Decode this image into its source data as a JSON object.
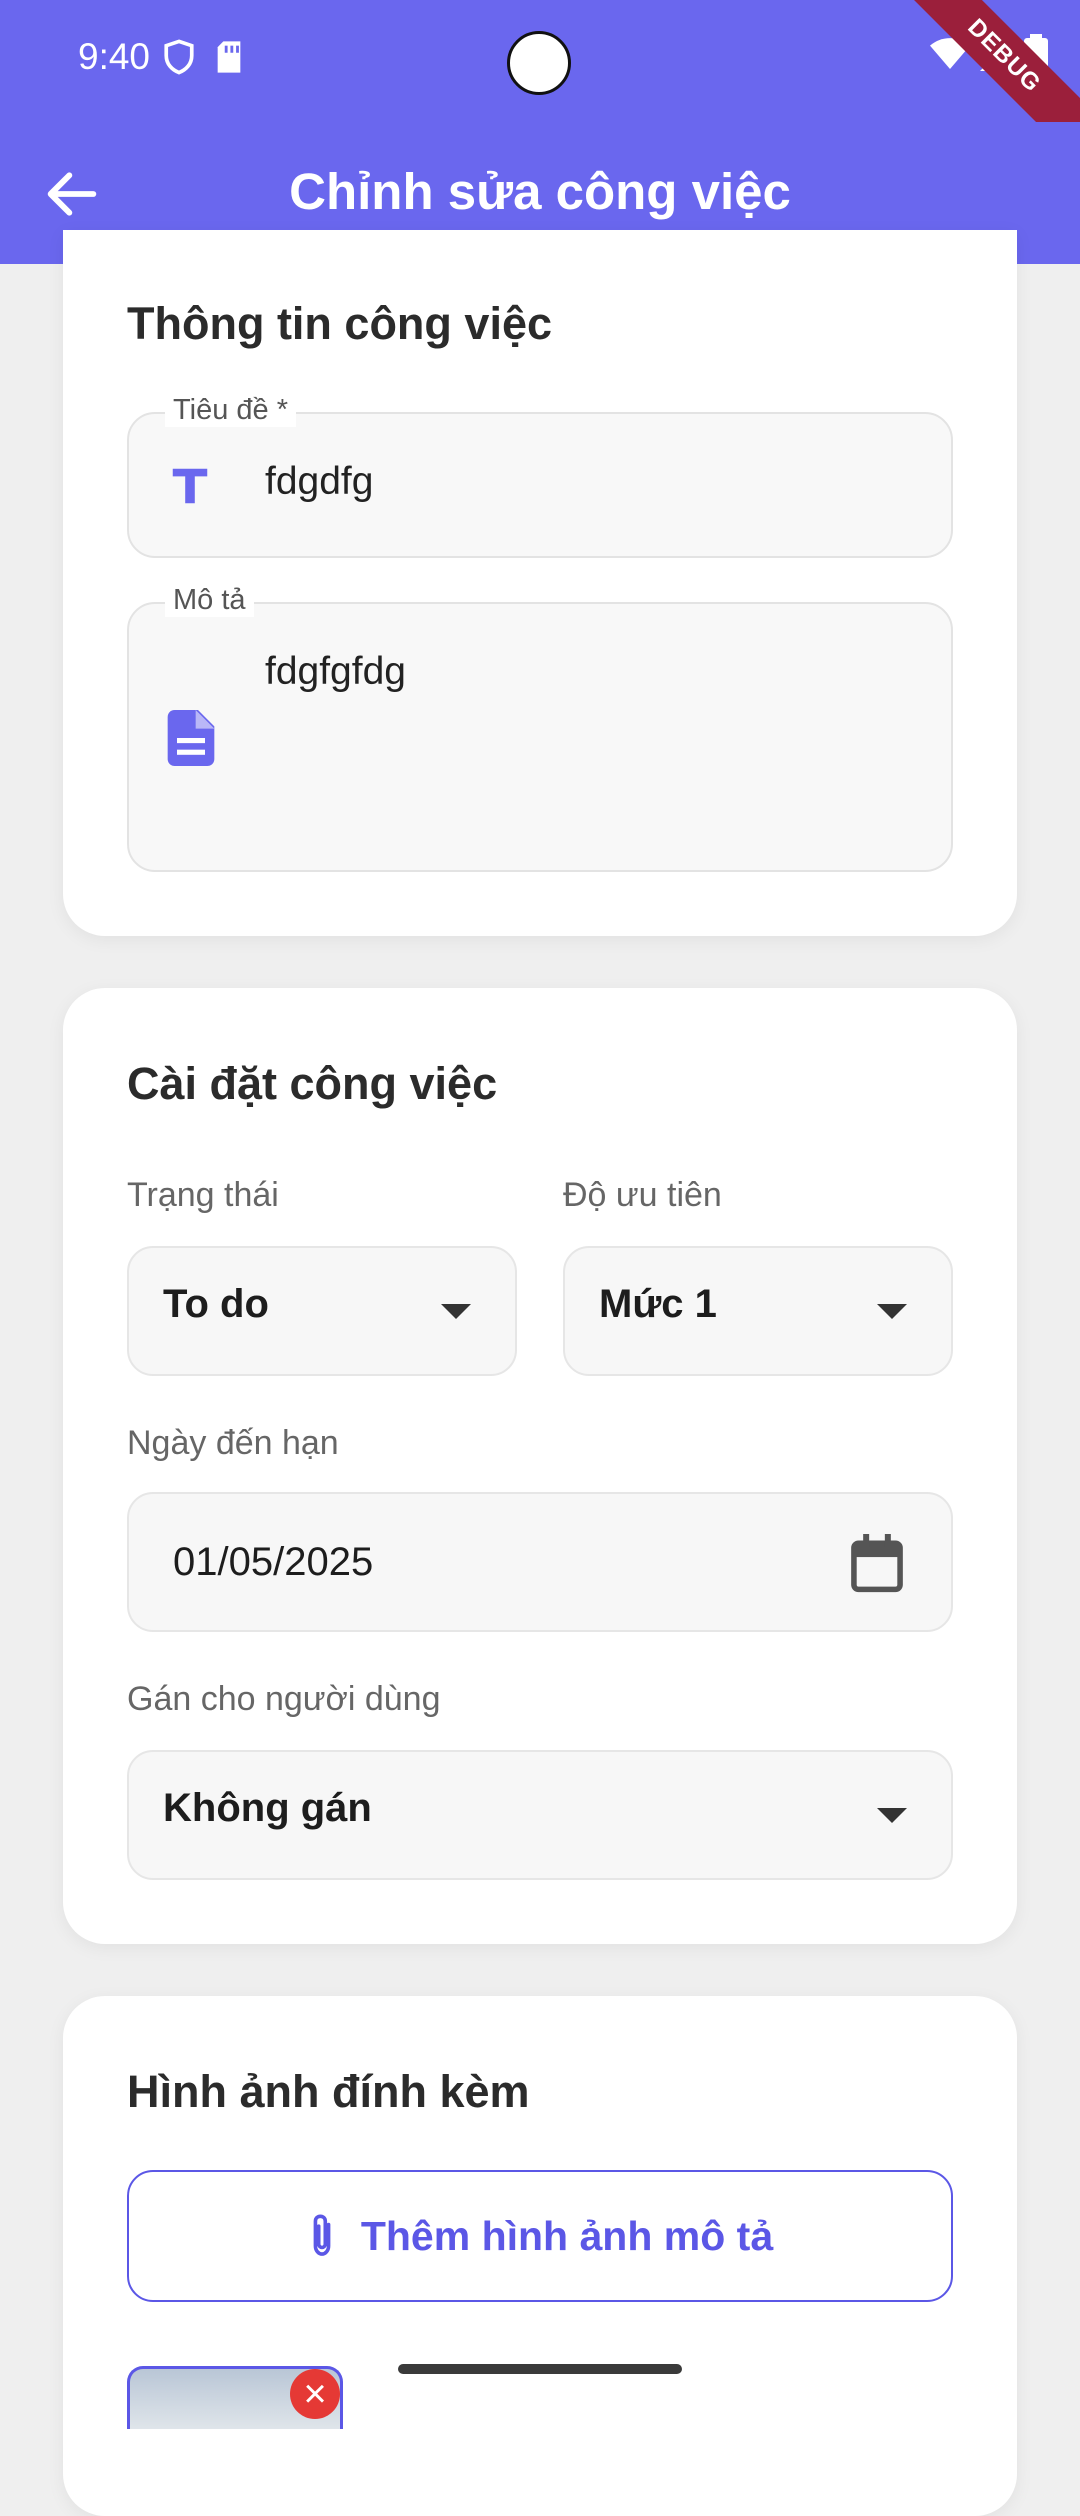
{
  "status_bar": {
    "time": "9:40",
    "debug_label": "DEBUG"
  },
  "app_bar": {
    "title": "Chỉnh sửa công việc"
  },
  "task_info": {
    "title": "Thông tin công việc",
    "title_field": {
      "label": "Tiêu đề *",
      "value": "fdgdfg",
      "icon": "title-icon"
    },
    "description_field": {
      "label": "Mô tả",
      "value": "fdgfgfdg",
      "icon": "description-icon"
    }
  },
  "task_settings": {
    "title": "Cài đặt công việc",
    "status": {
      "label": "Trạng thái",
      "value": "To do"
    },
    "priority": {
      "label": "Độ ưu tiên",
      "value": "Mức 1"
    },
    "due_date": {
      "label": "Ngày đến hạn",
      "value": "01/05/2025"
    },
    "assignee": {
      "label": "Gán cho người dùng",
      "value": "Không gán"
    }
  },
  "attachments": {
    "title": "Hình ảnh đính kèm",
    "add_button_label": "Thêm hình ảnh mô tả"
  },
  "colors": {
    "accent": "#6a67ee",
    "danger": "#e53935",
    "ribbon": "#9b1f3b"
  }
}
